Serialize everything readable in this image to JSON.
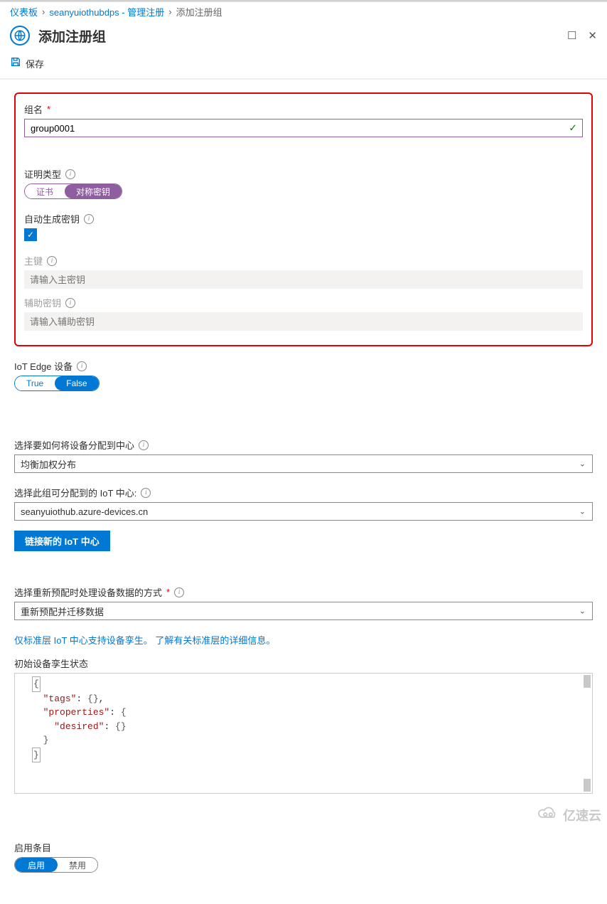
{
  "breadcrumb": {
    "dashboard": "仪表板",
    "resource": "seanyuiothubdps - 管理注册",
    "current": "添加注册组"
  },
  "header": {
    "title": "添加注册组"
  },
  "toolbar": {
    "save_label": "保存"
  },
  "group_name": {
    "label": "组名",
    "value": "group0001"
  },
  "attestation": {
    "label": "证明类型",
    "option_cert": "证书",
    "option_symkey": "对称密钥"
  },
  "autogen": {
    "label": "自动生成密钥"
  },
  "primary_key": {
    "label": "主键",
    "placeholder": "请输入主密钥"
  },
  "secondary_key": {
    "label": "辅助密钥",
    "placeholder": "请输入辅助密钥"
  },
  "iotedge": {
    "label": "IoT Edge 设备",
    "option_true": "True",
    "option_false": "False"
  },
  "allocation": {
    "label": "选择要如何将设备分配到中心",
    "value": "均衡加权分布"
  },
  "iothub_select": {
    "label": "选择此组可分配到的 IoT 中心:",
    "value": "seanyuiothub.azure-devices.cn"
  },
  "link_new_hub": {
    "label": "链接新的 IoT 中心"
  },
  "reprovision": {
    "label": "选择重新预配时处理设备数据的方式",
    "value": "重新预配并迁移数据"
  },
  "tier_hint": {
    "text1": "仅标准层 IoT 中心支持设备孪生。",
    "text2": "了解有关标准层的详细信息。"
  },
  "twin_state": {
    "label": "初始设备孪生状态",
    "code_key_tags": "\"tags\"",
    "code_key_properties": "\"properties\"",
    "code_key_desired": "\"desired\""
  },
  "enable_entry": {
    "label": "启用条目",
    "option_enable": "启用",
    "option_disable": "禁用"
  },
  "watermark": "亿速云"
}
